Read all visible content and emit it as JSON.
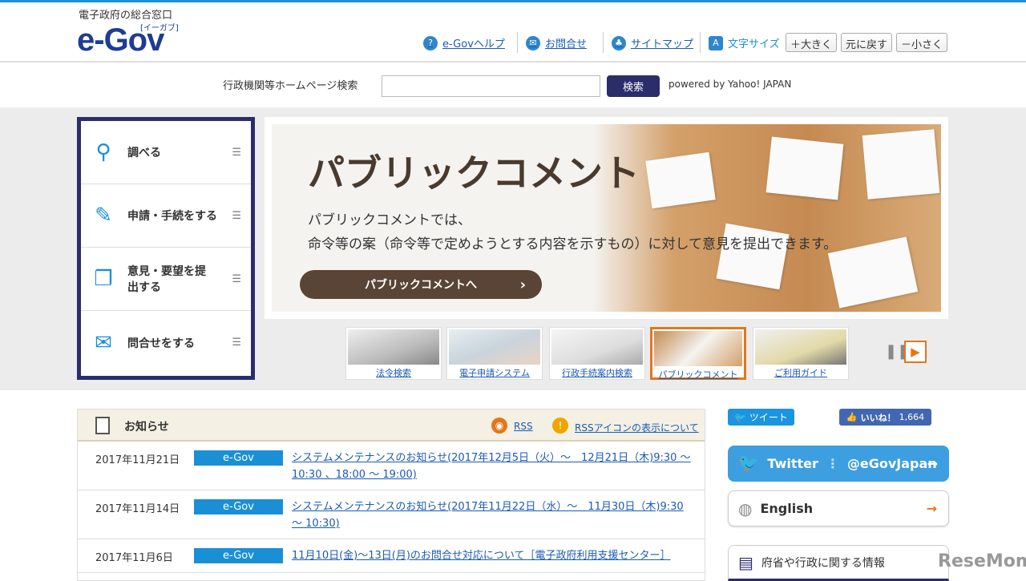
{
  "header": {
    "tagline": "電子政府の総合窓口",
    "logo": "e-Gov",
    "logo_sub": "[イーガブ]",
    "links": [
      {
        "label": "e-Govヘルプ",
        "icon": "?"
      },
      {
        "label": "お問合せ",
        "icon": "✉"
      },
      {
        "label": "サイトマップ",
        "icon": "♣"
      }
    ],
    "font_size_label": "文字サイズ",
    "font_buttons": [
      "＋大きく",
      "元に戻す",
      "－小さく"
    ]
  },
  "search": {
    "label": "行政機関等ホームページ検索",
    "value": "",
    "button": "検索",
    "powered": "powered by Yahoo! JAPAN"
  },
  "menu": [
    {
      "label": "調べる"
    },
    {
      "label": "申請・手続をする"
    },
    {
      "label": "意見・要望を提出する"
    },
    {
      "label": "問合せをする"
    }
  ],
  "banner": {
    "title": "パブリックコメント",
    "desc1": "パブリックコメントでは、",
    "desc2": "命令等の案（命令等で定めようとする内容を示すもの）に対して意見を提出できます。",
    "button": "パブリックコメントへ"
  },
  "thumbs": [
    {
      "label": "法令検索"
    },
    {
      "label": "電子申請システム"
    },
    {
      "label": "行政手続案内検索"
    },
    {
      "label": "パブリックコメント"
    },
    {
      "label": "ご利用ガイド"
    }
  ],
  "news": {
    "title": "お知らせ",
    "rss": "RSS",
    "rss_about": "RSSアイコンの表示について",
    "items": [
      {
        "date": "2017年11月21日",
        "tag": "e-Gov",
        "title": "システムメンテナンスのお知らせ(2017年12月5日（火）～　12月21日（木)9:30 ～ 10:30 、18:00 ～ 19:00)"
      },
      {
        "date": "2017年11月14日",
        "tag": "e-Gov",
        "title": "システムメンテナンスのお知らせ(2017年11月22日（水）～　11月30日（木)9:30 ～ 10:30)"
      },
      {
        "date": "2017年11月6日",
        "tag": "e-Gov",
        "title": "11月10日(金)～13日(月)のお問合せ対応について［電子政府利用支援センター］"
      }
    ]
  },
  "social": {
    "tweet": "ツイート",
    "like": "いいね！",
    "like_count": "1,664",
    "twitter": "Twitter",
    "twitter_handle": "@eGovJapan",
    "english": "English",
    "gov_info": "府省や行政に関する情報"
  },
  "watermark": "ReseMom"
}
